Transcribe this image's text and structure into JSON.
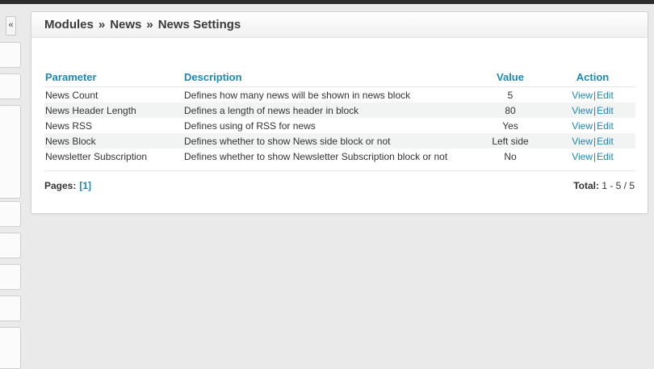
{
  "sidebar": {
    "collapse_label": "«"
  },
  "breadcrumb": {
    "items": [
      "Modules",
      "News",
      "News Settings"
    ],
    "separator": "»"
  },
  "table": {
    "headers": {
      "parameter": "Parameter",
      "description": "Description",
      "value": "Value",
      "action": "Action"
    },
    "rows": [
      {
        "parameter": "News Count",
        "description": "Defines how many news will be shown in news block",
        "value": "5",
        "view": "View",
        "edit": "Edit"
      },
      {
        "parameter": "News Header Length",
        "description": "Defines a length of news header in block",
        "value": "80",
        "view": "View",
        "edit": "Edit"
      },
      {
        "parameter": "News RSS",
        "description": "Defines using of RSS for news",
        "value": "Yes",
        "view": "View",
        "edit": "Edit"
      },
      {
        "parameter": "News Block",
        "description": "Defines whether to show News side block or not",
        "value": "Left side",
        "view": "View",
        "edit": "Edit"
      },
      {
        "parameter": "Newsletter Subscription",
        "description": "Defines whether to show Newsletter Subscription block or not",
        "value": "No",
        "view": "View",
        "edit": "Edit"
      }
    ],
    "action_separator": "|"
  },
  "pagination": {
    "label": "Pages:",
    "current": "[1]"
  },
  "total": {
    "label": "Total:",
    "value": "1 - 5 / 5"
  },
  "colors": {
    "link": "#1f88b5",
    "yes": "#219b21",
    "background": "#e9eae9"
  }
}
